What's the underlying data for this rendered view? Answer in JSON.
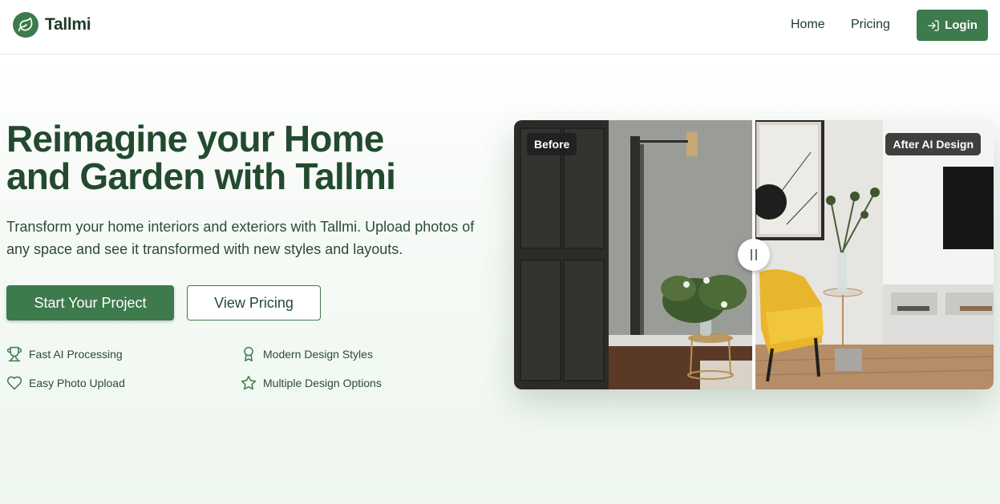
{
  "brand": {
    "name": "Tallmi",
    "logo_icon": "leaf-icon",
    "color": "#3d7a4c"
  },
  "nav": {
    "home": "Home",
    "pricing": "Pricing",
    "login": "Login",
    "login_icon": "login-icon"
  },
  "hero": {
    "title": "Reimagine your Home and Garden with Tallmi",
    "subtitle": "Transform your home interiors and exteriors with Tallmi. Upload photos of any space and see it transformed with new styles and layouts.",
    "primary_cta": "Start Your Project",
    "secondary_cta": "View Pricing"
  },
  "features": [
    {
      "label": "Fast AI Processing",
      "icon": "trophy-icon"
    },
    {
      "label": "Modern Design Styles",
      "icon": "award-icon"
    },
    {
      "label": "Easy Photo Upload",
      "icon": "heart-icon"
    },
    {
      "label": "Multiple Design Options",
      "icon": "star-icon"
    }
  ],
  "comparison": {
    "before_label": "Before",
    "after_label": "After AI Design",
    "slider_position": 0.5
  }
}
